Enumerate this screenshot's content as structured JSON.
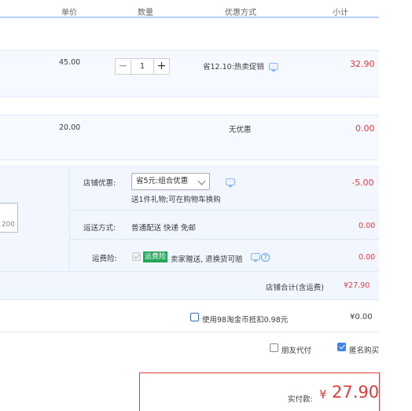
{
  "table_header": {
    "unit_price": "单价",
    "quantity": "数量",
    "discount_method": "优惠方式",
    "subtotal": "小计"
  },
  "items": [
    {
      "price": "45.00",
      "quantity": "1",
      "discount": "省12.10:热卖促销",
      "subtotal": "32.90"
    },
    {
      "price": "20.00",
      "discount": "无优惠",
      "subtotal": "0.00"
    }
  ],
  "stepper": {
    "minus": "−",
    "plus": "+"
  },
  "shop": {
    "message_count": "200",
    "discount_label": "店铺优惠:",
    "discount_selected": "省5元:组合优惠",
    "discount_note": "送1件礼物;可在购物车换购",
    "discount_amount": "-5.00",
    "shipping_label": "运送方式:",
    "shipping_value": "普通配送 快递 免邮",
    "shipping_amount": "0.00",
    "insurance_label": "运费险:",
    "insurance_badge": "运费险",
    "insurance_text": "卖家赠送, 退换货可赔",
    "insurance_amount": "0.00",
    "total_label": "店铺合计(含运费)",
    "total_value": "¥27.90"
  },
  "coin": {
    "label": "使用98淘金币抵扣0.98元",
    "amount": "¥0.00"
  },
  "options": {
    "friend_pay": "朋友代付",
    "anonymous": "匿名购买"
  },
  "payment": {
    "label": "实付款:",
    "currency": "¥",
    "amount": "27.90"
  },
  "colors": {
    "accent_red": "#e4393c",
    "header_line": "#b2d1ff",
    "shop_bg": "#f2f7ff",
    "checkbox_blue": "#3a86ec",
    "badge_green": "#26a65b"
  }
}
